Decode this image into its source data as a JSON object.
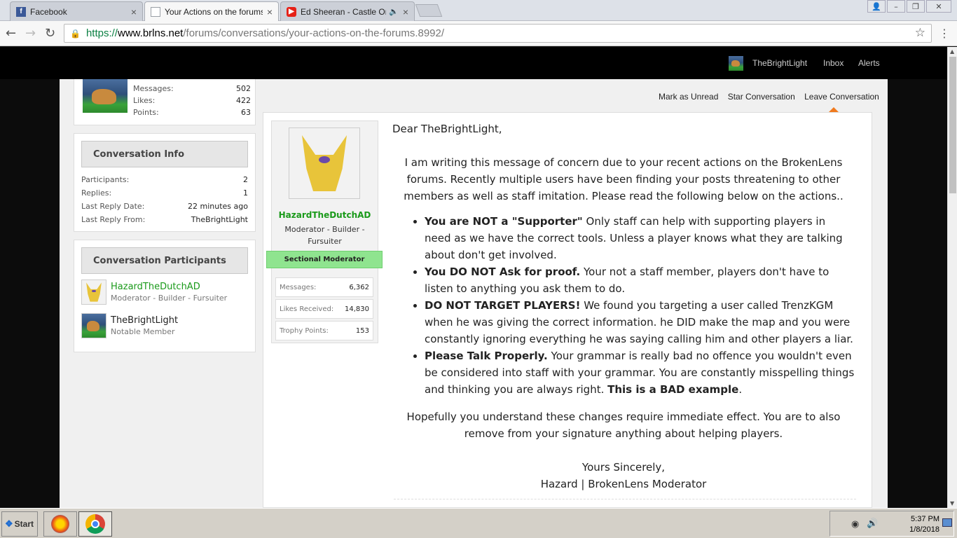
{
  "browser": {
    "tabs": [
      {
        "title": "Facebook",
        "icon": "facebook-icon",
        "color": "#3b5998"
      },
      {
        "title": "Your Actions on the forums",
        "icon": "page-icon",
        "color": "#9aa0a6"
      },
      {
        "title": "Ed Sheeran - Castle On",
        "icon": "youtube-icon",
        "color": "#e62117"
      }
    ],
    "url_secure": "https://",
    "url_host": "www.brlns.net",
    "url_path": "/forums/conversations/your-actions-on-the-forums.8992/"
  },
  "site_header": {
    "username": "TheBrightLight",
    "inbox": "Inbox",
    "alerts": "Alerts"
  },
  "sidebar": {
    "my_stats": [
      {
        "label": "Messages:",
        "value": "502"
      },
      {
        "label": "Likes:",
        "value": "422"
      },
      {
        "label": "Points:",
        "value": "63"
      }
    ],
    "conversation_info_title": "Conversation Info",
    "conversation_info": [
      {
        "label": "Participants:",
        "value": "2"
      },
      {
        "label": "Replies:",
        "value": "1"
      },
      {
        "label": "Last Reply Date:",
        "value": "22 minutes ago"
      },
      {
        "label": "Last Reply From:",
        "value": "TheBrightLight"
      }
    ],
    "participants_title": "Conversation Participants",
    "participants": [
      {
        "name": "HazardTheDutchAD",
        "role": "Moderator - Builder - Fursuiter",
        "name_color": "#1a9a1a"
      },
      {
        "name": "TheBrightLight",
        "role": "Notable Member",
        "name_color": "#222222"
      }
    ]
  },
  "actions": {
    "mark_unread": "Mark as Unread",
    "star": "Star Conversation",
    "leave": "Leave Conversation"
  },
  "message": {
    "author": "HazardTheDutchAD",
    "author_title": "Moderator - Builder - Fursuiter",
    "badge": "Sectional Moderator",
    "stats": [
      {
        "label": "Messages:",
        "value": "6,362"
      },
      {
        "label": "Likes Received:",
        "value": "14,830"
      },
      {
        "label": "Trophy Points:",
        "value": "153"
      }
    ],
    "greeting": "Dear TheBrightLight,",
    "intro": "I am writing this message of concern due to your recent actions on the BrokenLens forums. Recently multiple users have been finding your posts threatening to other members as well as staff imitation. Please read the following below on the actions..",
    "points": [
      {
        "bold": "You are NOT a \"Supporter\"",
        "text": " Only staff can help with supporting players in need as we have the correct tools. Unless a player knows what they are talking about don't get involved."
      },
      {
        "bold": "You DO NOT Ask for proof.",
        "text": " Your not a staff member, players don't have to listen to anything you ask them to do."
      },
      {
        "bold": "DO NOT TARGET PLAYERS!",
        "text": " We found you targeting a user called TrenzKGM when he was giving the correct information. he DID make the map and you were constantly ignoring everything he was saying calling him and other players a liar."
      },
      {
        "bold": "Please Talk Properly.",
        "text": " Your grammar is really bad no offence you wouldn't even be considered into staff with your grammar. You are constantly misspelling things and thinking you are always right. ",
        "bold2": "This is a BAD example",
        "tail": "."
      }
    ],
    "closing": "Hopefully you understand these changes require immediate effect. You are to also remove from your signature anything about helping players.",
    "signoff": "Yours Sincerely,",
    "signature": "Hazard | BrokenLens Moderator"
  },
  "taskbar": {
    "start": "Start",
    "time": "5:37 PM",
    "date": "1/8/2018"
  }
}
